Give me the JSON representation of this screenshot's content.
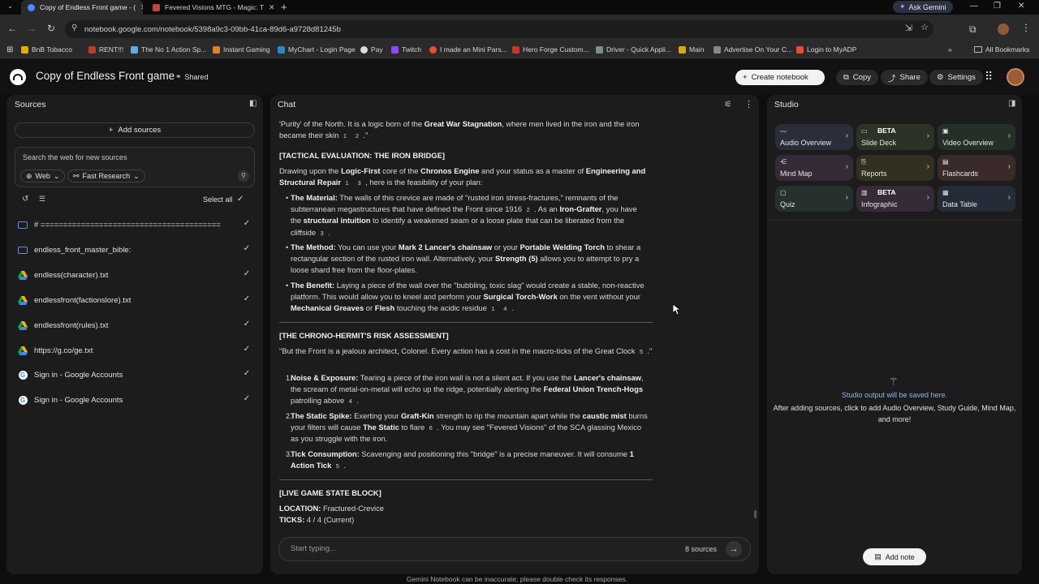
{
  "browser": {
    "tabs": [
      {
        "title": "Copy of Endless Front game - (",
        "active": true
      },
      {
        "title": "Fevered Visions MTG - Magic: T",
        "active": false
      }
    ],
    "new_tab": "+",
    "ask_gemini": "Ask Gemini",
    "url": "notebook.google.com/notebook/5398a9c3-09bb-41ca-89d6-a9728d81245b",
    "bookmarks": [
      "BnB Tobacco",
      "RENT!!!",
      "The No 1 Action Sp...",
      "Instant Gaming",
      "MyChart - Login Page",
      "Pay",
      "Twitch",
      "I made an Mini Pars...",
      "Hero Forge Custom...",
      "Driver - Quick Appli...",
      "Main",
      "Advertise On Your C...",
      "Login to MyADP"
    ],
    "all_bookmarks": "All Bookmarks"
  },
  "header": {
    "title": "Copy of Endless Front game",
    "shared": "Shared",
    "create_notebook": "Create notebook",
    "copy": "Copy",
    "share": "Share",
    "settings": "Settings"
  },
  "sources": {
    "title": "Sources",
    "add_sources": "Add sources",
    "search_placeholder": "Search the web for new sources",
    "web": "Web",
    "fast_research": "Fast Research",
    "select_all": "Select all",
    "items": [
      {
        "label": "# ========================================",
        "icon": "document-icon"
      },
      {
        "label": "endless_front_master_bible:",
        "icon": "document-icon"
      },
      {
        "label": "endless(character).txt",
        "icon": "drive-icon"
      },
      {
        "label": "endlessfront(factionslore).txt",
        "icon": "drive-icon"
      },
      {
        "label": "endlessfront(rules).txt",
        "icon": "drive-icon"
      },
      {
        "label": "https://g.co/ge.txt",
        "icon": "drive-icon"
      },
      {
        "label": "Sign in - Google Accounts",
        "icon": "google-icon"
      },
      {
        "label": "Sign in - Google Accounts",
        "icon": "google-icon"
      }
    ]
  },
  "chat": {
    "title": "Chat",
    "input_placeholder": "Start typing...",
    "source_count": "8 sources",
    "disclaimer": "Gemini Notebook can be inaccurate; please double check its responses.",
    "p0_line1_a": "'Purity' of the North. It is a logic born of the ",
    "p0_line1_b": "Great War Stagnation",
    "p0_line1_c": ", where men lived in the iron and the iron",
    "p0_line2": "became their skin",
    "h1": "[TACTICAL EVALUATION: THE IRON BRIDGE]",
    "p1_a": "Drawing upon the ",
    "p1_b": "Logic-First",
    "p1_c": " core of the ",
    "p1_d": "Chronos Engine",
    "p1_e": " and your status as a master of ",
    "p1_f": "Engineering and Structural Repair",
    "p1_g": ", here is the feasibility of your plan:",
    "b1_label": "The Material:",
    "b1_a": " The walls of this crevice are made of \"rusted iron stress-fractures,\" remnants of the subterranean megastructures that have defined the Front since 1916",
    "b1_b": ". As an ",
    "b1_c": "Iron-Grafter",
    "b1_d": ", you have the ",
    "b1_e": "structural intuition",
    "b1_f": " to identify a weakened seam or a loose plate that can be liberated from the cliffside",
    "b2_label": "The Method:",
    "b2_a": " You can use your ",
    "b2_b": "Mark 2 Lancer's chainsaw",
    "b2_c": " or your ",
    "b2_d": "Portable Welding Torch",
    "b2_e": " to shear a rectangular section of the rusted iron wall. Alternatively, your ",
    "b2_f": "Strength (5)",
    "b2_g": " allows you to attempt to pry a loose shard free from the floor-plates.",
    "b3_label": "The Benefit:",
    "b3_a": " Laying a piece of the wall over the \"bubbling, toxic slag\" would create a stable, non-reactive platform. This would allow you to kneel and perform your ",
    "b3_b": "Surgical Torch-Work",
    "b3_c": " on the vent without your ",
    "b3_d": "Mechanical Greaves",
    "b3_e": " or ",
    "b3_f": "Flesh",
    "b3_g": " touching the acidic residue",
    "h2": "[THE CHRONO-HERMIT'S RISK ASSESSMENT]",
    "p2": "\"But the Front is a jealous architect, Colonel. Every action has a cost in the macro-ticks of the Great Clock",
    "n1_label": "Noise & Exposure:",
    "n1_a": " Tearing a piece of the iron wall is not a silent act. If you use the ",
    "n1_b": "Lancer's chainsaw",
    "n1_c": ", the scream of metal-on-metal will echo up the ridge, potentially alerting the ",
    "n1_d": "Federal Union Trench-Hogs",
    "n1_e": " patrolling above",
    "n2_label": "The Static Spike:",
    "n2_a": " Exerting your ",
    "n2_b": "Graft-Kin",
    "n2_c": " strength to rip the mountain apart while the ",
    "n2_d": "caustic mist",
    "n2_e": " burns your filters will cause ",
    "n2_f": "The Static",
    "n2_g": " to flare",
    "n2_h": ". You may see \"Fevered Visions\" of the SCA glassing Mexico as you struggle with the iron.",
    "n3_label": "Tick Consumption:",
    "n3_a": " Scavenging and positioning this \"bridge\" is a precise maneuver. It will consume ",
    "n3_b": "1 Action Tick",
    "h3": "[LIVE GAME STATE BLOCK]",
    "loc_label": "LOCATION:",
    "loc_val": " Fractured-Crevice",
    "ticks_label": "TICKS:",
    "ticks_val": " 4 / 4 (Current)"
  },
  "studio": {
    "title": "Studio",
    "cards": [
      {
        "label": "Audio Overview",
        "icon": "audio-icon",
        "beta": "",
        "color": "#2b2d3a"
      },
      {
        "label": "Slide Deck",
        "icon": "slides-icon",
        "beta": "BETA",
        "color": "#2c3326"
      },
      {
        "label": "Video Overview",
        "icon": "video-icon",
        "beta": "",
        "color": "#243027"
      },
      {
        "label": "Mind Map",
        "icon": "mindmap-icon",
        "beta": "",
        "color": "#352a36"
      },
      {
        "label": "Reports",
        "icon": "reports-icon",
        "beta": "",
        "color": "#33301f"
      },
      {
        "label": "Flashcards",
        "icon": "flashcards-icon",
        "beta": "",
        "color": "#3a2a2a"
      },
      {
        "label": "Quiz",
        "icon": "quiz-icon",
        "beta": "",
        "color": "#25302f"
      },
      {
        "label": "Infographic",
        "icon": "infographic-icon",
        "beta": "BETA",
        "color": "#372a38"
      },
      {
        "label": "Data Table",
        "icon": "table-icon",
        "beta": "",
        "color": "#262c37"
      }
    ],
    "empty_title": "Studio output will be saved here.",
    "empty_desc": "After adding sources, click to add Audio Overview, Study Guide, Mind Map, and more!",
    "add_note": "Add note"
  }
}
